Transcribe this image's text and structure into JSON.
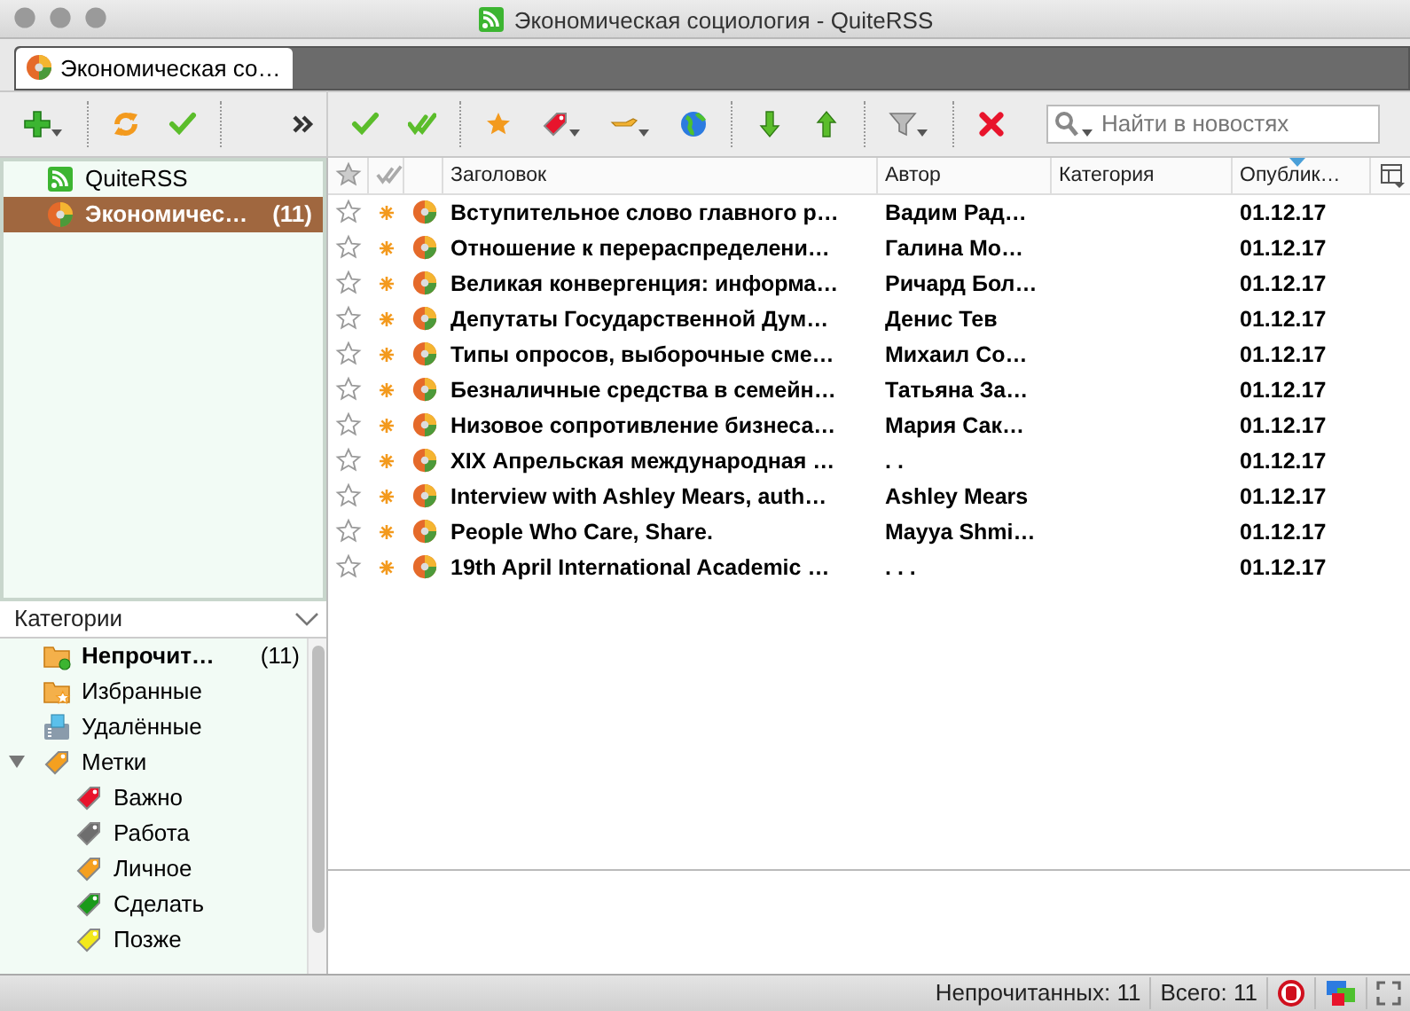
{
  "window": {
    "title": "Экономическая социология - QuiteRSS"
  },
  "tabs": [
    {
      "label": "Экономическая со…",
      "selected": true
    }
  ],
  "search": {
    "placeholder": "Найти в новостях"
  },
  "feeds": [
    {
      "name": "QuiteRSS",
      "kind": "app",
      "selected": false
    },
    {
      "name": "Экономичес…",
      "count": "(11)",
      "kind": "feed",
      "selected": true
    }
  ],
  "categories": {
    "title": "Категории",
    "items": [
      {
        "kind": "unread",
        "name": "Непрочит…",
        "count": "(11)"
      },
      {
        "kind": "starred",
        "name": "Избранные"
      },
      {
        "kind": "deleted",
        "name": "Удалённые"
      },
      {
        "kind": "labels",
        "name": "Метки",
        "expanded": true,
        "children": [
          {
            "name": "Важно",
            "color": "#e8142c"
          },
          {
            "name": "Работа",
            "color": "#6e6e6e"
          },
          {
            "name": "Личное",
            "color": "#f5a020"
          },
          {
            "name": "Сделать",
            "color": "#1a9a1a"
          },
          {
            "name": "Позже",
            "color": "#f2e81c"
          }
        ]
      }
    ]
  },
  "table": {
    "columns": [
      "Заголовок",
      "Автор",
      "Категория",
      "Опублик…"
    ],
    "rows": [
      {
        "title": "Вступительное слово главного р…",
        "author": "Вадим Рад…",
        "date": "01.12.17",
        "starred": false,
        "unread": true
      },
      {
        "title": "Отношение к перераспределени…",
        "author": "Галина Мо…",
        "date": "01.12.17",
        "starred": false,
        "unread": true
      },
      {
        "title": "Великая конвергенция: информа…",
        "author": "Ричард Бол…",
        "date": "01.12.17",
        "starred": false,
        "unread": true
      },
      {
        "title": "Депутаты Государственной Дум…",
        "author": "Денис Тев",
        "date": "01.12.17",
        "starred": false,
        "unread": true
      },
      {
        "title": "Типы опросов, выборочные сме…",
        "author": "Михаил Со…",
        "date": "01.12.17",
        "starred": false,
        "unread": true
      },
      {
        "title": "Безналичные средства в семейн…",
        "author": "Татьяна За…",
        "date": "01.12.17",
        "starred": false,
        "unread": true
      },
      {
        "title": "Низовое сопротивление бизнеса…",
        "author": "Мария Сак…",
        "date": "01.12.17",
        "starred": false,
        "unread": true
      },
      {
        "title": "XIX Апрельская международная …",
        "author": ". .",
        "date": "01.12.17",
        "starred": false,
        "unread": true
      },
      {
        "title": "Interview with Ashley Mears, auth…",
        "author": "Ashley Mears",
        "date": "01.12.17",
        "starred": false,
        "unread": true
      },
      {
        "title": "People Who Care, Share.",
        "author": "Mayya Shmi…",
        "date": "01.12.17",
        "starred": false,
        "unread": true
      },
      {
        "title": "19th April International Academic …",
        "author": ". . .",
        "date": "01.12.17",
        "starred": false,
        "unread": true
      }
    ]
  },
  "status_bar": {
    "unread": "Непрочитанных: 11",
    "total": "Всего: 11"
  }
}
